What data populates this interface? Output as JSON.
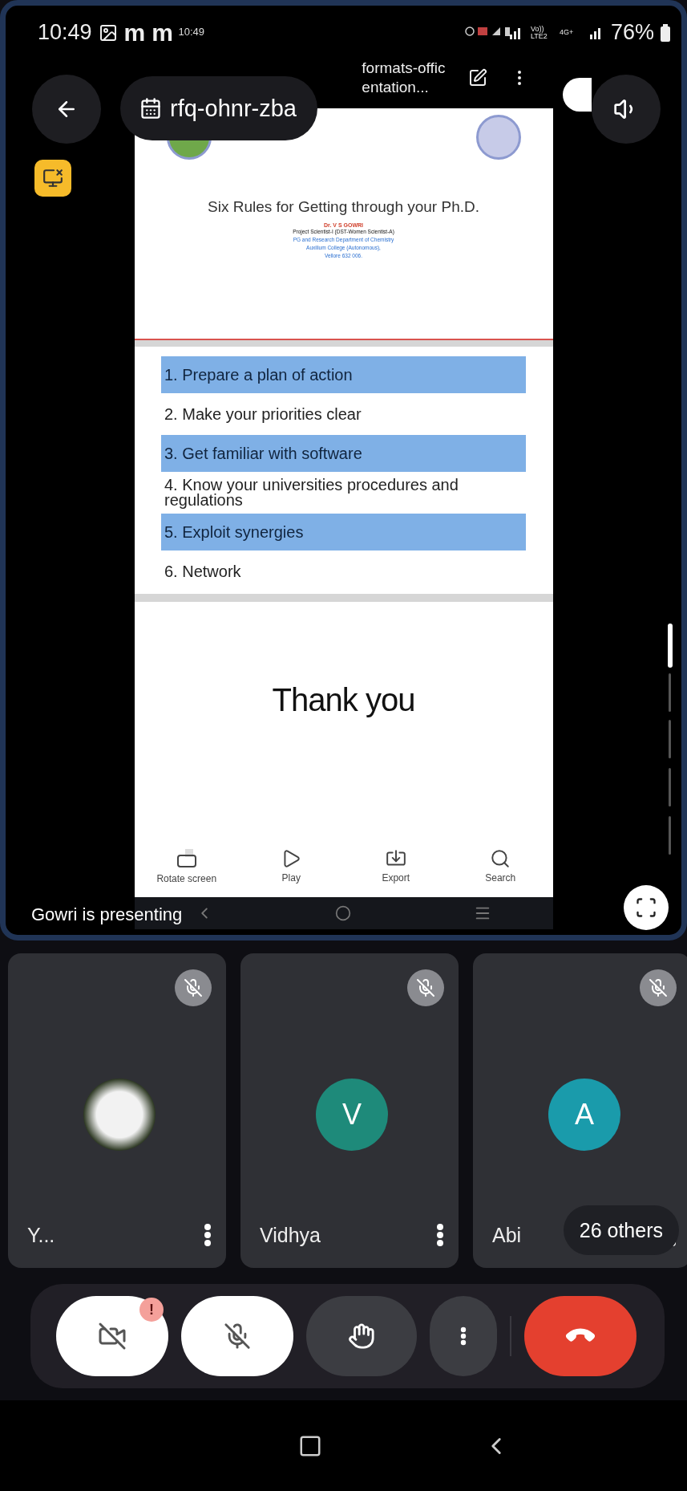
{
  "device_status": {
    "time": "10:49",
    "notification_icons": [
      "m",
      "m"
    ],
    "network_labels": [
      "Vo)) LTE2",
      "4G+"
    ],
    "battery": "76%"
  },
  "shared_screen": {
    "status_time": "10:49",
    "app_title": [
      "formats-offic",
      "entation..."
    ],
    "slides": [
      {
        "kind": "title",
        "title": "Six Rules for Getting through your Ph.D.",
        "author": "Dr. V S GOWRI",
        "position": "Project Scientist-I (DST-Women Scientist-A)",
        "affiliation": [
          "PG and Research Department of Chemistry",
          "Auxilium College (Autonomous),",
          "Vellore 632 006."
        ]
      },
      {
        "kind": "list",
        "items": [
          {
            "text": "1. Prepare a plan of action",
            "highlighted": true
          },
          {
            "text": "2. Make your priorities clear",
            "highlighted": false
          },
          {
            "text": "3. Get familiar with software",
            "highlighted": true
          },
          {
            "text": "4. Know your universities procedures and regulations",
            "highlighted": false
          },
          {
            "text": "5. Exploit synergies",
            "highlighted": true
          },
          {
            "text": "6. Network",
            "highlighted": false
          }
        ]
      },
      {
        "kind": "closing",
        "text": "Thank you"
      }
    ],
    "toolbar": [
      {
        "kind": "rotate",
        "label": "Rotate screen"
      },
      {
        "kind": "play",
        "label": "Play"
      },
      {
        "kind": "export",
        "label": "Export"
      },
      {
        "kind": "search",
        "label": "Search"
      }
    ]
  },
  "meeting": {
    "code": "rfq-ohnr-zba",
    "presenter_label": "Gowri is presenting"
  },
  "participants": [
    {
      "kind": "photo",
      "name": "Y...",
      "muted": true
    },
    {
      "kind": "initial",
      "name": "Vidhya",
      "initial": "V",
      "color": "#1e8a7a",
      "muted": true
    },
    {
      "kind": "initial",
      "name": "Abi",
      "initial": "A",
      "color": "#1a9bab",
      "muted": true
    }
  ],
  "others": "26 others",
  "controls": {
    "camera_on": false,
    "camera_alert": "!",
    "mic_on": false
  }
}
